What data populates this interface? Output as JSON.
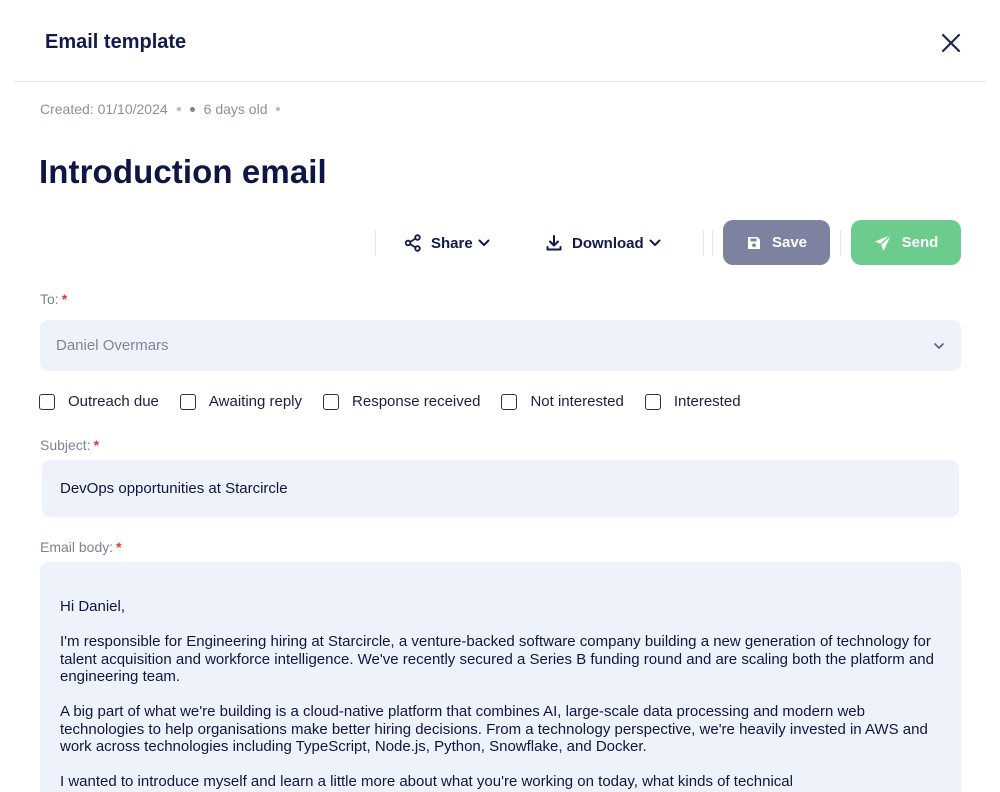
{
  "header": {
    "title": "Email template",
    "close_icon": "close-icon"
  },
  "meta": {
    "created": "Created: 01/10/2024",
    "age": "6 days old"
  },
  "page_title": "Introduction email",
  "toolbar": {
    "share_label": "Share",
    "download_label": "Download",
    "save_label": "Save",
    "send_label": "Send",
    "colors": {
      "save": "#7d82a0",
      "send": "#6ccc8e"
    }
  },
  "to": {
    "label": "To:",
    "required": "*",
    "value": "Daniel Overmars"
  },
  "statuses": [
    "Outreach due",
    "Awaiting reply",
    "Response received",
    "Not interested",
    "Interested"
  ],
  "subject": {
    "label": "Subject:",
    "required": "*",
    "value": "DevOps opportunities at Starcircle"
  },
  "body": {
    "label": "Email body:",
    "required": "*",
    "paragraphs": [
      "Hi Daniel,",
      "I'm responsible for Engineering hiring at Starcircle, a venture-backed software company building a new generation of technology for talent acquisition and workforce intelligence. We've recently secured a Series B funding round and are scaling both the platform and engineering team.",
      "A big part of what we're building is a cloud-native platform that combines AI, large-scale data processing and modern web technologies to help organisations make better hiring decisions. From a technology perspective, we're heavily invested in AWS and work across technologies including TypeScript, Node.js, Python, Snowflake, and Docker.",
      "I wanted to introduce myself and learn a little more about what you're working on today, what kinds of technical"
    ]
  }
}
